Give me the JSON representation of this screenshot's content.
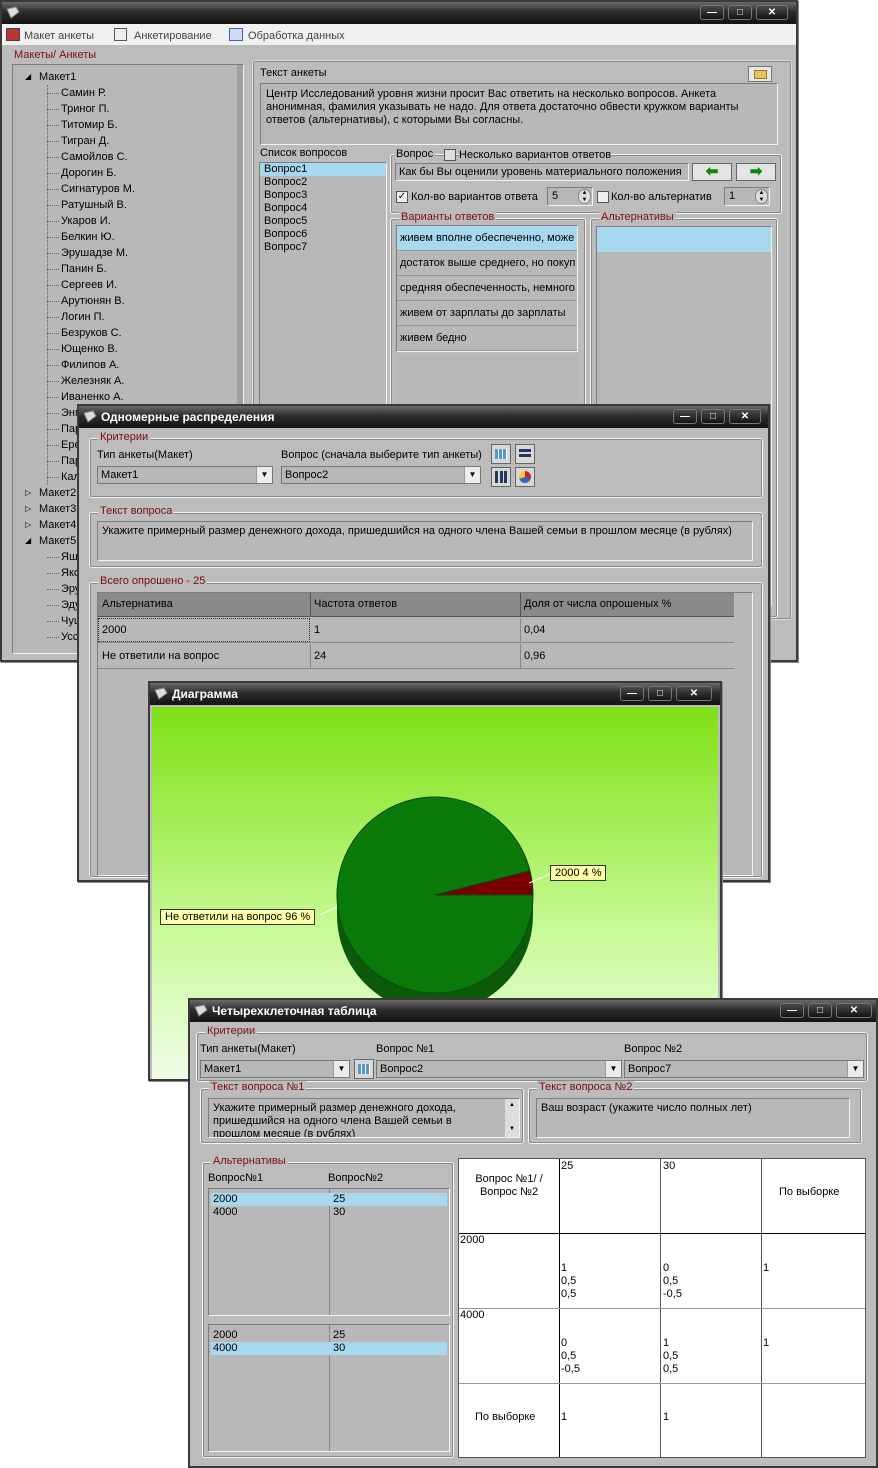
{
  "main": {
    "menu": [
      "Макет анкеты",
      "Анкетирование",
      "Обработка данных"
    ],
    "tree_title": "Макеты/ Анкеты",
    "tree_root": "Макет1",
    "tree_items": [
      "Самин Р.",
      "Триног П.",
      "Титомир Б.",
      "Тигран Д.",
      "Самойлов С.",
      "Дорогин Б.",
      "Сигнатуров М.",
      "Ратушный В.",
      "Укаров И.",
      "Белкин Ю.",
      "Эрушадзе М.",
      "Панин Б.",
      "Сергеев И.",
      "Арутюнян В.",
      "Логин П.",
      "Безруков С.",
      "Ющенко В.",
      "Филипов А.",
      "Железняк А.",
      "Иваненко А.",
      "Энг",
      "Пар",
      "Ере",
      "Пар",
      "Кал"
    ],
    "tree_roots2": [
      "Макет2",
      "Макет3",
      "Макет4",
      "Макет5"
    ],
    "tree_items5": [
      "Яшк",
      "Яко",
      "Эру",
      "Эду",
      "Чуш",
      "Усс"
    ],
    "survey_text_label": "Текст анкеты",
    "survey_text": "Центр Исследований уровня жизни просит Вас ответить на несколько вопросов. Анкета анонимная, фамилия указывать не надо. Для ответа достаточно обвести кружком варианты ответов (альтернативы), с которыми Вы согласны.",
    "questions_label": "Список вопросов",
    "questions": [
      "Вопрос1",
      "Вопрос2",
      "Вопрос3",
      "Вопрос4",
      "Вопрос5",
      "Вопрос6",
      "Вопрос7"
    ],
    "question_label": "Вопрос",
    "multi_label": "Несколько вариантов ответов",
    "question_text": "Как бы Вы оценили уровень материального положения",
    "count_label": "Кол-во вариантов ответа",
    "count_value": "5",
    "alt_count_label": "Кол-во альтернатив",
    "alt_count_value": "1",
    "answers_label": "Варианты ответов",
    "answers": [
      "живем вполне обеспеченно, може",
      "достаток выше среднего, но покуп",
      "средняя обеспеченность, немного",
      "живем от зарплаты до зарплаты",
      "живем бедно"
    ],
    "alternatives_label": "Альтернативы"
  },
  "dist": {
    "title": "Одномерные распределения",
    "criteria": "Критерии",
    "type_label": "Тип анкеты(Макет)",
    "type_value": "Макет1",
    "question_label": "Вопрос (сначала выберите тип анкеты)",
    "question_value": "Вопрос2",
    "qtext_label": "Текст вопроса",
    "qtext": "Укажите примерный размер денежного дохода, пришедшийся на одного члена Вашей семьи в прошлом месяце (в рублях)",
    "total": "Всего опрошено - 25",
    "headers": [
      "Альтернатива",
      "Частота ответов",
      "Доля от числа опрошеных %"
    ],
    "rows": [
      [
        "2000",
        "1",
        "0,04"
      ],
      [
        "Не ответили на вопрос",
        "24",
        "0,96"
      ]
    ]
  },
  "chart": {
    "title": "Диаграмма",
    "chart_data": {
      "type": "pie",
      "labels": [
        "2000 4 %",
        "Не ответили на вопрос 96 %"
      ],
      "values": [
        4,
        96
      ],
      "colors": [
        "#7a0000",
        "#0a7a0a"
      ]
    }
  },
  "four": {
    "title": "Четырехклеточная таблица",
    "criteria": "Критерии",
    "type_label": "Тип анкеты(Макет)",
    "type_value": "Макет1",
    "q1_label": "Вопрос №1",
    "q1_value": "Вопрос2",
    "q2_label": "Вопрос №2",
    "q2_value": "Вопрос7",
    "t1_label": "Текст вопроса №1",
    "t1": "Укажите примерный размер денежного дохода, пришедшийся на одного члена Вашей семьи в прошлом месяце (в рублях)",
    "t2_label": "Текст вопроса №2",
    "t2": "Ваш возраст (укажите число полных лет)",
    "alt_label": "Альтернативы",
    "col1": "Вопрос№1",
    "col2": "Вопрос№2",
    "list1": [
      [
        "2000",
        "25"
      ],
      [
        "4000",
        "30"
      ]
    ],
    "list2": [
      [
        "2000",
        "25"
      ],
      [
        "4000",
        "30"
      ]
    ],
    "grid_head": "Вопрос №1/ /Вопрос №2",
    "grid_cols": [
      "25",
      "30",
      "По выборке"
    ],
    "grid_rows": [
      {
        "label": "2000",
        "c1": [
          "1",
          "0,5",
          "0,5"
        ],
        "c2": [
          "0",
          "0,5",
          "-0,5"
        ],
        "c3": "1"
      },
      {
        "label": "4000",
        "c1": [
          "0",
          "0,5",
          "-0,5"
        ],
        "c2": [
          "1",
          "0,5",
          "0,5"
        ],
        "c3": "1"
      }
    ],
    "total_row": {
      "label": "По выборке",
      "c1": "1",
      "c2": "1"
    }
  }
}
